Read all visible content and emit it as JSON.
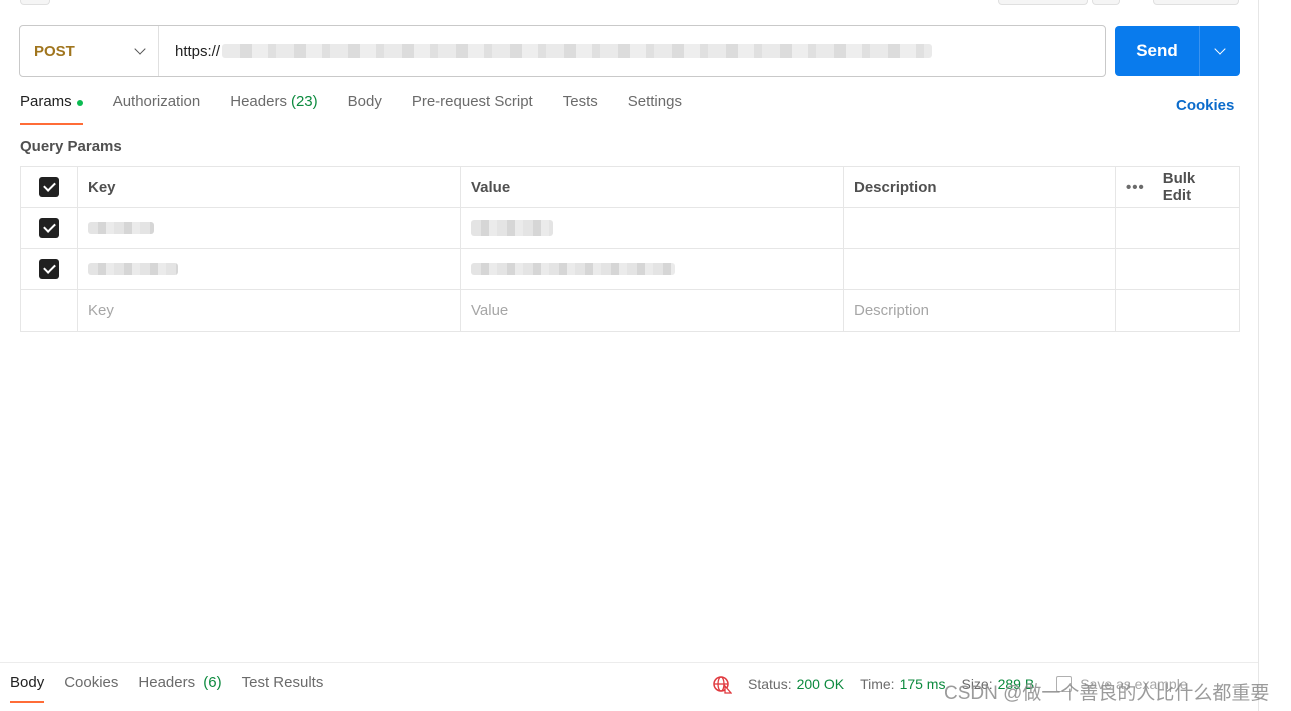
{
  "request": {
    "method": "POST",
    "url_prefix": "https://",
    "send_label": "Send"
  },
  "tabs": [
    {
      "label": "Params",
      "active": true,
      "dot": true
    },
    {
      "label": "Authorization"
    },
    {
      "label": "Headers",
      "count": "(23)"
    },
    {
      "label": "Body"
    },
    {
      "label": "Pre-request Script"
    },
    {
      "label": "Tests"
    },
    {
      "label": "Settings"
    }
  ],
  "cookies_link": "Cookies",
  "query_params": {
    "title": "Query Params",
    "headers": {
      "key": "Key",
      "value": "Value",
      "description": "Description",
      "more": "•••",
      "bulk_edit": "Bulk Edit"
    },
    "placeholders": {
      "key": "Key",
      "value": "Value",
      "description": "Description"
    }
  },
  "response": {
    "tabs": [
      {
        "label": "Body",
        "active": true
      },
      {
        "label": "Cookies"
      },
      {
        "label": "Headers",
        "count": "(6)"
      },
      {
        "label": "Test Results"
      }
    ],
    "status_label": "Status:",
    "status_value": "200 OK",
    "time_label": "Time:",
    "time_value": "175 ms",
    "size_label": "Size:",
    "size_value": "289 B",
    "save_example": "Save as example"
  },
  "watermark": "CSDN @做一个善良的人比什么都重要",
  "colors": {
    "accent": "#ff6c37",
    "send": "#097bed",
    "method": "#a0751e",
    "success": "#0c8a3e"
  }
}
